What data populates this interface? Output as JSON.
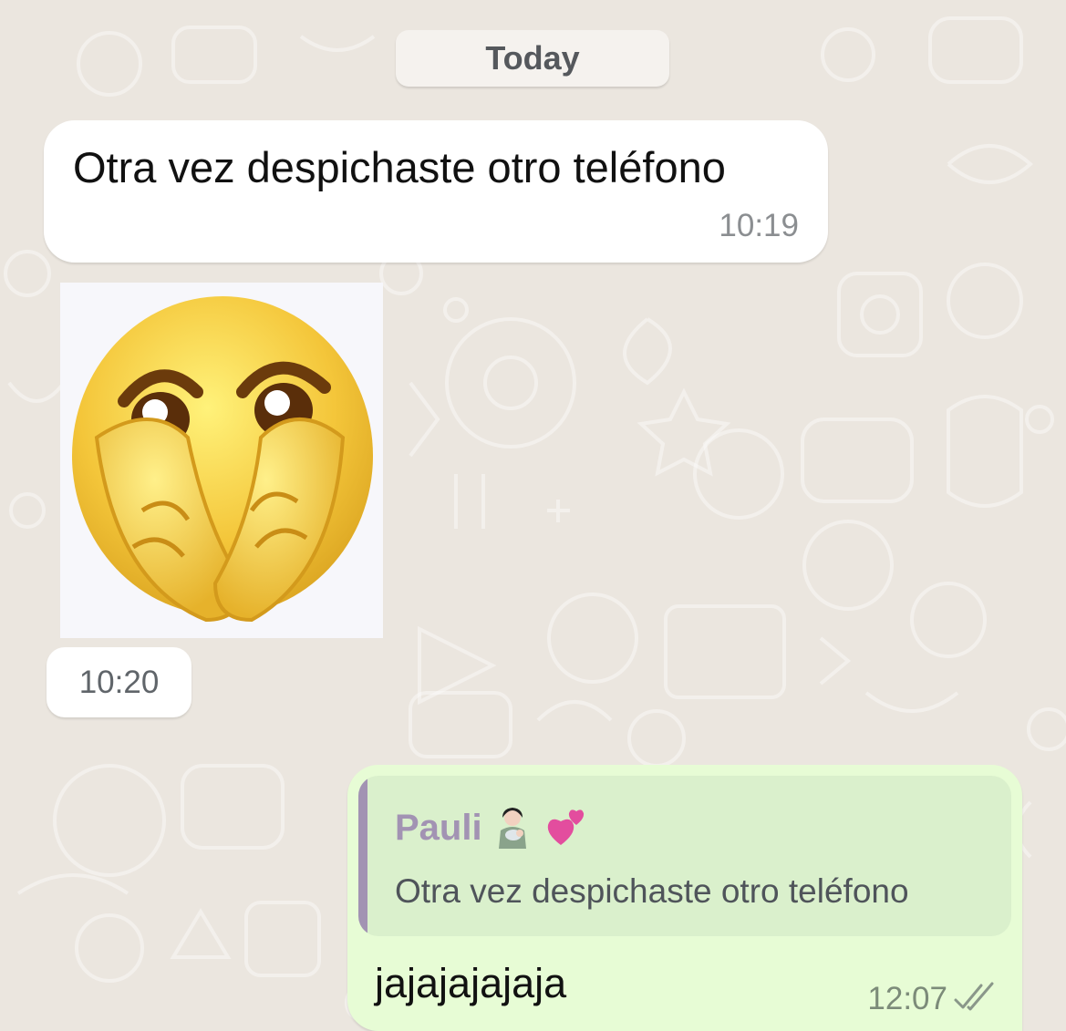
{
  "date_separator": "Today",
  "messages": {
    "incoming_text": {
      "text": "Otra vez despichaste otro teléfono",
      "time": "10:19"
    },
    "incoming_sticker": {
      "sticker_icon": "crying-face-sticker-icon",
      "time": "10:20"
    },
    "outgoing_reply": {
      "quoted_author": "Pauli",
      "quoted_author_emojis": [
        "woman-feeding-baby-icon",
        "two-hearts-icon"
      ],
      "quoted_text": "Otra vez despichaste otro teléfono",
      "text": "jajajajajaja",
      "time": "12:07",
      "status_icon": "double-check-icon"
    }
  },
  "colors": {
    "wallpaper": "#ebe6df",
    "incoming_bubble": "#ffffff",
    "outgoing_bubble": "#e7fcd5",
    "quote_background": "#daf0cc",
    "quote_accent": "#a293b3"
  }
}
